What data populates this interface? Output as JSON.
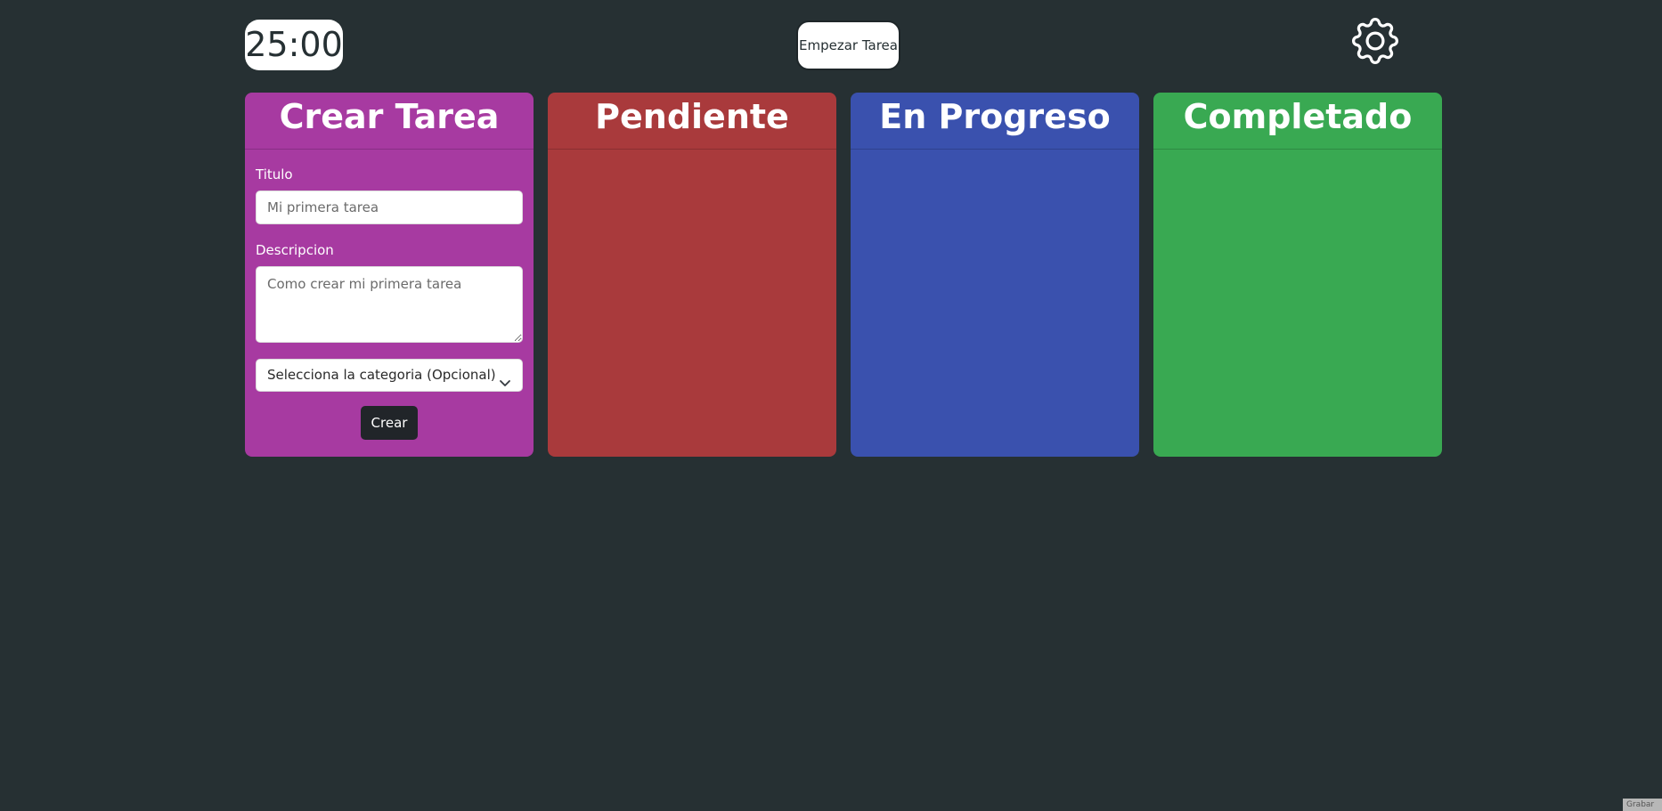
{
  "header": {
    "timer": "25:00",
    "start_button": "Empezar Tarea",
    "settings_icon": "gear-icon"
  },
  "columns": {
    "create": {
      "title": "Crear Tarea",
      "color": "#a73aa1"
    },
    "pending": {
      "title": "Pendiente",
      "color": "#a93a3c"
    },
    "progress": {
      "title": "En Progreso",
      "color": "#3a51ae"
    },
    "done": {
      "title": "Completado",
      "color": "#39a952"
    }
  },
  "form": {
    "title_label": "Titulo",
    "title_placeholder": "Mi primera tarea",
    "description_label": "Descripcion",
    "description_placeholder": "Como crear mi primera tarea",
    "category_selected": "Selecciona la categoria (Opcional)",
    "submit_label": "Crear"
  },
  "footer": {
    "corner_text": "Grabar"
  }
}
